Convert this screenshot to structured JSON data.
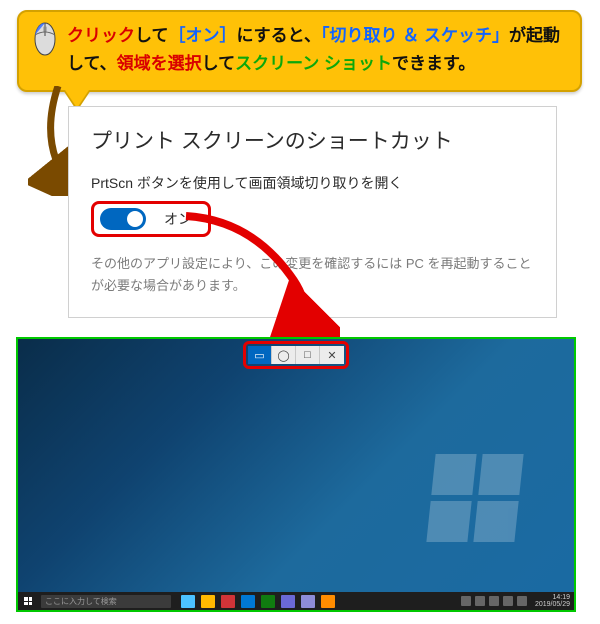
{
  "callout": {
    "parts": [
      {
        "cls": "clr-red",
        "text": "クリック"
      },
      {
        "cls": "clr-black",
        "text": "して"
      },
      {
        "cls": "clr-blue",
        "text": "［オン］"
      },
      {
        "cls": "clr-black",
        "text": "にすると、"
      },
      {
        "cls": "clr-blue",
        "text": "「切り取り ＆ スケッチ」"
      },
      {
        "cls": "clr-black",
        "text": "が起動して、"
      },
      {
        "cls": "clr-red",
        "text": "領域を選択"
      },
      {
        "cls": "clr-black",
        "text": "して"
      },
      {
        "cls": "clr-green",
        "text": "スクリーン ショット"
      },
      {
        "cls": "clr-black",
        "text": "できます。"
      }
    ]
  },
  "settings": {
    "heading": "プリント スクリーンのショートカット",
    "subtitle": "PrtScn ボタンを使用して画面領域切り取りを開く",
    "toggle_label": "オン",
    "note": "その他のアプリ設定により、この変更を確認するには PC を再起動することが必要な場合があります。"
  },
  "snip_toolbar": {
    "buttons": [
      "▭",
      "◯",
      "□",
      "✕"
    ],
    "active_index": 0
  },
  "taskbar": {
    "search_placeholder": "ここに入力して検索",
    "clock_time": "14:19",
    "clock_date": "2019/05/29",
    "pins": [
      "#4cc2ff",
      "#ffb900",
      "#d13438",
      "#0078d4",
      "#107c10",
      "#6b69d6",
      "#8e8cd8",
      "#ff8c00"
    ],
    "tray_count": 5
  }
}
